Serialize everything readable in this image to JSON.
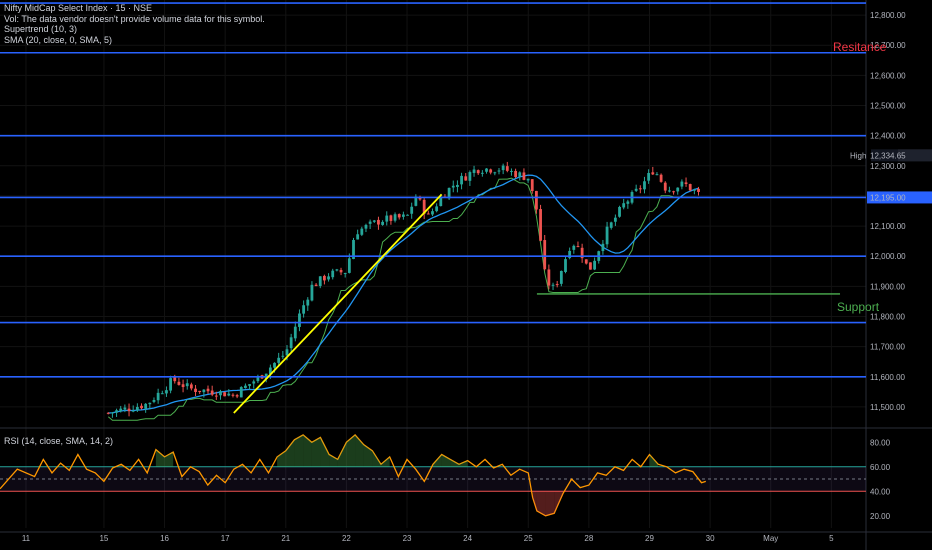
{
  "legend": {
    "title": "Nifty MidCap Select Index · 15 · NSE",
    "vol": "Vol: The data vendor doesn't provide volume data for this symbol.",
    "supertrend": "Supertrend (10, 3)",
    "sma": "SMA (20, close, 0, SMA, 5)"
  },
  "rsi_legend": "RSI (14, close, SMA, 14, 2)",
  "annotations": {
    "resistance": "Resitance",
    "support": "Support"
  },
  "price_labels": {
    "high_tag": "High",
    "high_value": "12,334.65",
    "current_value": "12,195.00"
  },
  "colors": {
    "background": "#000000",
    "level_line": "#2962ff",
    "trend_line": "#ffff00",
    "support_line": "#4caf50",
    "up_candle": "#26a69a",
    "down_candle": "#ef5350",
    "sma": "#2196f3",
    "supertrend_up": "#4caf50",
    "supertrend_down": "#ef5350",
    "rsi": "#ff9800",
    "resistance_text": "#f23645",
    "support_text": "#4caf50"
  },
  "chart_data": {
    "type": "candlestick",
    "price_axis": {
      "ylim": [
        11450,
        12850
      ],
      "ticks": [
        {
          "v": 11500,
          "label": "11,500.00"
        },
        {
          "v": 11600,
          "label": "11,600.00"
        },
        {
          "v": 11700,
          "label": "11,700.00"
        },
        {
          "v": 11800,
          "label": "11,800.00"
        },
        {
          "v": 11900,
          "label": "11,900.00"
        },
        {
          "v": 12000,
          "label": "12,000.00"
        },
        {
          "v": 12100,
          "label": "12,100.00"
        },
        {
          "v": 12200,
          "label": "12,200.00"
        },
        {
          "v": 12300,
          "label": "12,300.00"
        },
        {
          "v": 12400,
          "label": "12,400.00"
        },
        {
          "v": 12500,
          "label": "12,500.00"
        },
        {
          "v": 12600,
          "label": "12,600.00"
        },
        {
          "v": 12700,
          "label": "12,700.00"
        },
        {
          "v": 12800,
          "label": "12,800.00"
        }
      ]
    },
    "x_axis": {
      "xlim": [
        0,
        100
      ],
      "ticks": [
        {
          "x": 3,
          "label": "11"
        },
        {
          "x": 12,
          "label": "15"
        },
        {
          "x": 19,
          "label": "16"
        },
        {
          "x": 26,
          "label": "17"
        },
        {
          "x": 33,
          "label": "21"
        },
        {
          "x": 40,
          "label": "22"
        },
        {
          "x": 47,
          "label": "23"
        },
        {
          "x": 54,
          "label": "24"
        },
        {
          "x": 61,
          "label": "25"
        },
        {
          "x": 68,
          "label": "28"
        },
        {
          "x": 75,
          "label": "29"
        },
        {
          "x": 82,
          "label": "30"
        },
        {
          "x": 89,
          "label": "May"
        },
        {
          "x": 96,
          "label": "5"
        }
      ]
    },
    "horizontal_levels": [
      12840,
      12675,
      12400,
      12195,
      12000,
      11780,
      11600
    ],
    "support_level": {
      "value": 11875,
      "x_from": 62,
      "x_to": 97
    },
    "trend_line": {
      "from": {
        "x": 27,
        "y": 11480
      },
      "to": {
        "x": 51,
        "y": 12205
      }
    },
    "anchors": [
      {
        "x": 12.5,
        "y": 11480
      },
      {
        "x": 17,
        "y": 11510
      },
      {
        "x": 20,
        "y": 11590
      },
      {
        "x": 22,
        "y": 11560
      },
      {
        "x": 25,
        "y": 11550
      },
      {
        "x": 27,
        "y": 11540
      },
      {
        "x": 30,
        "y": 11600
      },
      {
        "x": 33,
        "y": 11680
      },
      {
        "x": 34.5,
        "y": 11800
      },
      {
        "x": 36,
        "y": 11900
      },
      {
        "x": 38,
        "y": 11940
      },
      {
        "x": 40,
        "y": 11950
      },
      {
        "x": 41,
        "y": 12080
      },
      {
        "x": 44,
        "y": 12120
      },
      {
        "x": 47,
        "y": 12130
      },
      {
        "x": 48,
        "y": 12200
      },
      {
        "x": 49.5,
        "y": 12130
      },
      {
        "x": 51,
        "y": 12200
      },
      {
        "x": 52.5,
        "y": 12240
      },
      {
        "x": 55,
        "y": 12290
      },
      {
        "x": 58,
        "y": 12290
      },
      {
        "x": 61,
        "y": 12260
      },
      {
        "x": 62,
        "y": 12150
      },
      {
        "x": 63,
        "y": 11920
      },
      {
        "x": 64,
        "y": 11890
      },
      {
        "x": 66,
        "y": 12050
      },
      {
        "x": 67,
        "y": 12020
      },
      {
        "x": 68,
        "y": 11950
      },
      {
        "x": 70,
        "y": 12080
      },
      {
        "x": 72,
        "y": 12170
      },
      {
        "x": 74,
        "y": 12230
      },
      {
        "x": 75.5,
        "y": 12290
      },
      {
        "x": 77,
        "y": 12220
      },
      {
        "x": 79,
        "y": 12240
      },
      {
        "x": 81,
        "y": 12200
      }
    ],
    "rsi": {
      "ylim": [
        10,
        90
      ],
      "upper_band": 60,
      "lower_band": 40,
      "mid": 50,
      "ticks": [
        {
          "v": 20,
          "label": "20.00"
        },
        {
          "v": 40,
          "label": "40.00"
        },
        {
          "v": 60,
          "label": "60.00"
        },
        {
          "v": 80,
          "label": "80.00"
        }
      ],
      "points": [
        {
          "x": 0,
          "y": 42
        },
        {
          "x": 2,
          "y": 58
        },
        {
          "x": 4,
          "y": 52
        },
        {
          "x": 5,
          "y": 66
        },
        {
          "x": 6,
          "y": 55
        },
        {
          "x": 7,
          "y": 63
        },
        {
          "x": 8,
          "y": 57
        },
        {
          "x": 9,
          "y": 70
        },
        {
          "x": 10,
          "y": 58
        },
        {
          "x": 11,
          "y": 55
        },
        {
          "x": 12,
          "y": 48
        },
        {
          "x": 13,
          "y": 59
        },
        {
          "x": 14,
          "y": 62
        },
        {
          "x": 15,
          "y": 57
        },
        {
          "x": 16,
          "y": 66
        },
        {
          "x": 17,
          "y": 55
        },
        {
          "x": 18,
          "y": 74
        },
        {
          "x": 19,
          "y": 68
        },
        {
          "x": 20,
          "y": 72
        },
        {
          "x": 21,
          "y": 52
        },
        {
          "x": 22,
          "y": 60
        },
        {
          "x": 23,
          "y": 56
        },
        {
          "x": 24,
          "y": 45
        },
        {
          "x": 25,
          "y": 53
        },
        {
          "x": 26,
          "y": 47
        },
        {
          "x": 27,
          "y": 58
        },
        {
          "x": 28,
          "y": 62
        },
        {
          "x": 29,
          "y": 55
        },
        {
          "x": 30,
          "y": 66
        },
        {
          "x": 31,
          "y": 55
        },
        {
          "x": 32,
          "y": 68
        },
        {
          "x": 33,
          "y": 73
        },
        {
          "x": 34,
          "y": 82
        },
        {
          "x": 35,
          "y": 86
        },
        {
          "x": 36,
          "y": 80
        },
        {
          "x": 37,
          "y": 84
        },
        {
          "x": 38,
          "y": 70
        },
        {
          "x": 39,
          "y": 66
        },
        {
          "x": 40,
          "y": 80
        },
        {
          "x": 41,
          "y": 86
        },
        {
          "x": 42,
          "y": 78
        },
        {
          "x": 43,
          "y": 73
        },
        {
          "x": 44,
          "y": 62
        },
        {
          "x": 45,
          "y": 68
        },
        {
          "x": 46,
          "y": 52
        },
        {
          "x": 47,
          "y": 66
        },
        {
          "x": 48,
          "y": 58
        },
        {
          "x": 49,
          "y": 48
        },
        {
          "x": 50,
          "y": 62
        },
        {
          "x": 51,
          "y": 70
        },
        {
          "x": 52,
          "y": 66
        },
        {
          "x": 53,
          "y": 62
        },
        {
          "x": 54,
          "y": 65
        },
        {
          "x": 55,
          "y": 60
        },
        {
          "x": 56,
          "y": 66
        },
        {
          "x": 57,
          "y": 59
        },
        {
          "x": 58,
          "y": 62
        },
        {
          "x": 59,
          "y": 53
        },
        {
          "x": 60,
          "y": 58
        },
        {
          "x": 61,
          "y": 55
        },
        {
          "x": 61.5,
          "y": 35
        },
        {
          "x": 62,
          "y": 24
        },
        {
          "x": 63,
          "y": 20
        },
        {
          "x": 64,
          "y": 22
        },
        {
          "x": 65,
          "y": 38
        },
        {
          "x": 66,
          "y": 50
        },
        {
          "x": 67,
          "y": 43
        },
        {
          "x": 68,
          "y": 45
        },
        {
          "x": 69,
          "y": 55
        },
        {
          "x": 70,
          "y": 53
        },
        {
          "x": 71,
          "y": 60
        },
        {
          "x": 72,
          "y": 57
        },
        {
          "x": 73,
          "y": 66
        },
        {
          "x": 74,
          "y": 60
        },
        {
          "x": 75,
          "y": 70
        },
        {
          "x": 76,
          "y": 62
        },
        {
          "x": 77,
          "y": 60
        },
        {
          "x": 78,
          "y": 55
        },
        {
          "x": 79,
          "y": 58
        },
        {
          "x": 80,
          "y": 56
        },
        {
          "x": 81,
          "y": 47
        },
        {
          "x": 81.5,
          "y": 48
        }
      ]
    }
  }
}
